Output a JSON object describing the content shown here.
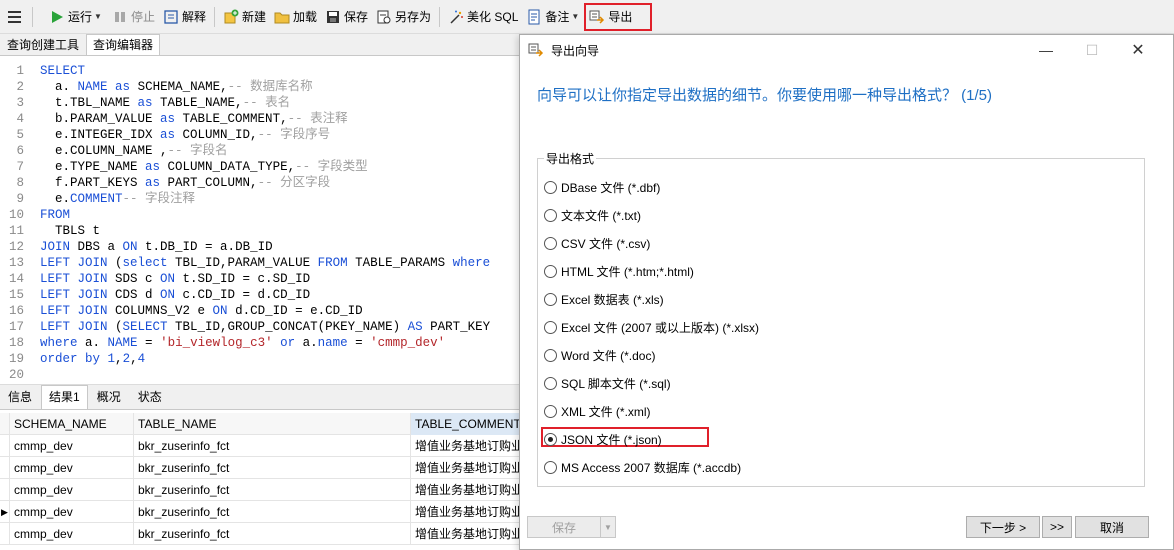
{
  "toolbar": {
    "run": "运行",
    "stop": "停止",
    "explain": "解释",
    "new": "新建",
    "load": "加载",
    "save": "保存",
    "save_as": "另存为",
    "beautify": "美化 SQL",
    "note": "备注",
    "export": "导出"
  },
  "tabs": [
    "查询创建工具",
    "查询编辑器"
  ],
  "editor": {
    "line_numbers": [
      "1",
      "2",
      "3",
      "4",
      "5",
      "6",
      "7",
      "8",
      "9",
      "10",
      "11",
      "12",
      "13",
      "14",
      "15",
      "16",
      "17",
      "18",
      "19",
      "20"
    ]
  },
  "result_tabs": [
    "信息",
    "结果1",
    "概况",
    "状态"
  ],
  "grid": {
    "columns": [
      "SCHEMA_NAME",
      "TABLE_NAME",
      "TABLE_COMMENT"
    ],
    "rows": [
      [
        "cmmp_dev",
        "bkr_zuserinfo_fct",
        "增值业务基地订购业"
      ],
      [
        "cmmp_dev",
        "bkr_zuserinfo_fct",
        "增值业务基地订购业"
      ],
      [
        "cmmp_dev",
        "bkr_zuserinfo_fct",
        "增值业务基地订购业"
      ],
      [
        "cmmp_dev",
        "bkr_zuserinfo_fct",
        "增值业务基地订购业"
      ],
      [
        "cmmp_dev",
        "bkr_zuserinfo_fct",
        "增值业务基地订购业"
      ]
    ]
  },
  "dialog": {
    "title": "导出向导",
    "heading": "向导可以让你指定导出数据的细节。你要使用哪一种导出格式？ (1/5)",
    "group_label": "导出格式",
    "options": [
      "DBase 文件 (*.dbf)",
      "文本文件 (*.txt)",
      "CSV 文件 (*.csv)",
      "HTML 文件 (*.htm;*.html)",
      "Excel 数据表 (*.xls)",
      "Excel 文件 (2007 或以上版本) (*.xlsx)",
      "Word 文件 (*.doc)",
      "SQL 脚本文件 (*.sql)",
      "XML 文件 (*.xml)",
      "JSON 文件 (*.json)",
      "MS Access 2007 数据库 (*.accdb)"
    ],
    "selected_option": "JSON 文件 (*.json)",
    "save_btn": "保存",
    "next_btn": "下一步 >",
    "last_btn": ">>",
    "cancel_btn": "取消"
  },
  "colors": {
    "highlight": "#e0202a",
    "heading": "#1e6fc4",
    "keyword": "#1a4fd6"
  }
}
